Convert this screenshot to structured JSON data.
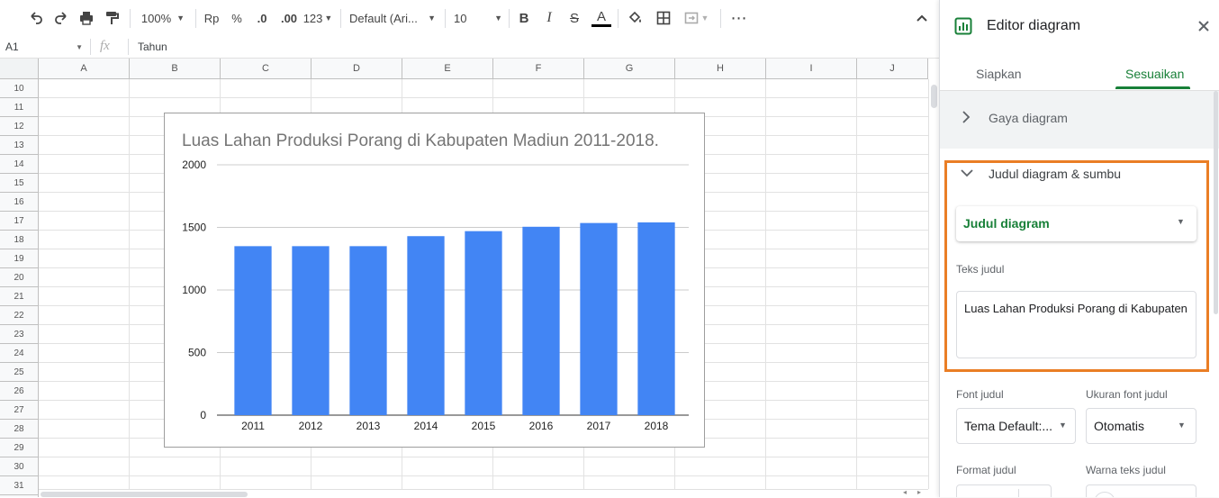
{
  "toolbar": {
    "zoom": "100%",
    "currency": "Rp",
    "percent": "%",
    "dec_decrease": ".0",
    "dec_increase": ".00",
    "more_formats": "123",
    "font": "Default (Ari...",
    "font_size": "10",
    "text_color": "#000000"
  },
  "formula_bar": {
    "cell_ref": "A1",
    "fx": "fx",
    "value": "Tahun"
  },
  "grid": {
    "columns": [
      "A",
      "B",
      "C",
      "D",
      "E",
      "F",
      "G",
      "H",
      "I",
      "J"
    ],
    "rows": [
      "10",
      "11",
      "12",
      "13",
      "14",
      "15",
      "16",
      "17",
      "18",
      "19",
      "20",
      "21",
      "22",
      "23",
      "24",
      "25",
      "26",
      "27",
      "28",
      "29",
      "30",
      "31"
    ]
  },
  "chart_data": {
    "type": "bar",
    "title": "Luas Lahan Produksi Porang di Kabupaten Madiun 2011-2018.",
    "categories": [
      "2011",
      "2012",
      "2013",
      "2014",
      "2015",
      "2016",
      "2017",
      "2018"
    ],
    "values": [
      1350,
      1350,
      1350,
      1430,
      1470,
      1505,
      1535,
      1540
    ],
    "ylim": [
      0,
      2000
    ],
    "yticks": [
      "0",
      "500",
      "1000",
      "1500",
      "2000"
    ],
    "bar_color": "#4285f4",
    "grid": true,
    "xlabel": "",
    "ylabel": ""
  },
  "panel": {
    "title": "Editor diagram",
    "tabs": [
      "Siapkan",
      "Sesuaikan"
    ],
    "active_tab": 1,
    "accent": "#188038",
    "section_style": "Gaya diagram",
    "section_titles": "Judul diagram & sumbu",
    "title_dropdown": "Judul diagram",
    "title_text_label": "Teks judul",
    "title_text_value": "Luas Lahan Produksi Porang di Kabupaten",
    "font_label": "Font judul",
    "font_value": "Tema Default:...",
    "size_label": "Ukuran font judul",
    "size_value": "Otomatis",
    "format_label": "Format judul",
    "color_label": "Warna teks judul",
    "highlight_color": "#ea7e25"
  }
}
